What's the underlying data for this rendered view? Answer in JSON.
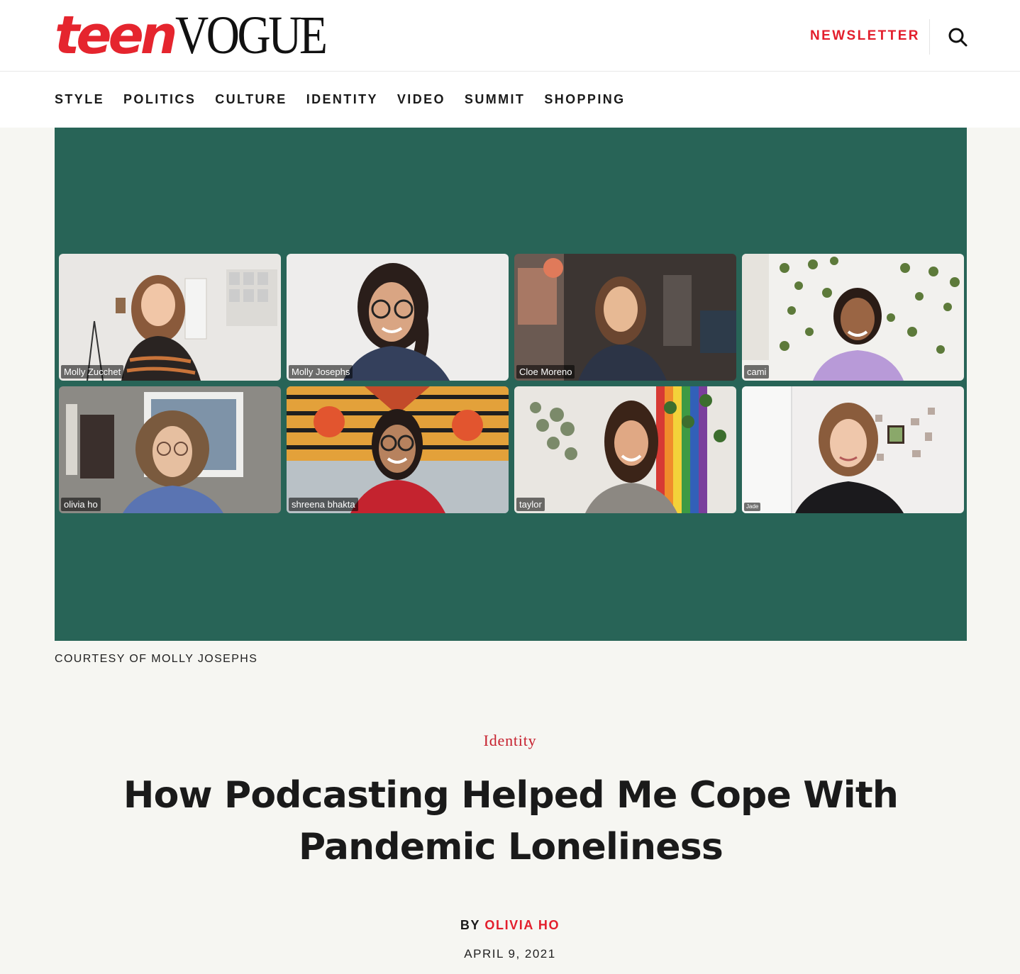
{
  "brand": {
    "logo_part1": "teen",
    "logo_part2": "VOGUE",
    "accent_color": "#e31e2c"
  },
  "header": {
    "newsletter_label": "NEWSLETTER",
    "search_icon": "search-icon"
  },
  "nav": {
    "items": [
      "STYLE",
      "POLITICS",
      "CULTURE",
      "IDENTITY",
      "VIDEO",
      "SUMMIT",
      "SHOPPING"
    ]
  },
  "hero": {
    "background_color": "#286457",
    "participants": [
      "Molly Zucchet",
      "Molly Josephs",
      "Cloe Moreno",
      "cami",
      "olivia ho",
      "shreena bhakta",
      "taylor",
      "Jade"
    ],
    "caption": "COURTESY OF MOLLY JOSEPHS"
  },
  "article": {
    "rubric": "Identity",
    "headline": "How Podcasting Helped Me Cope With Pandemic Loneliness",
    "byline_prefix": "BY",
    "author": "OLIVIA HO",
    "date": "APRIL 9, 2021"
  }
}
